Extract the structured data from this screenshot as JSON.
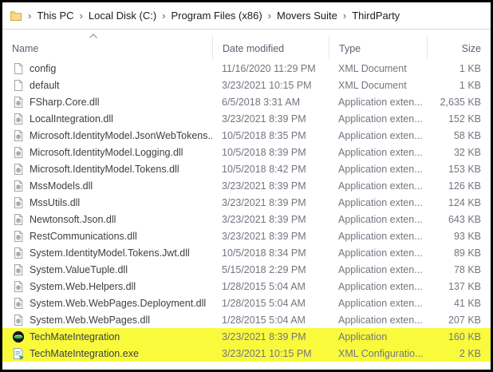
{
  "breadcrumb": {
    "icon": "folder-icon",
    "separator": "›",
    "items": [
      "This PC",
      "Local Disk (C:)",
      "Program Files (x86)",
      "Movers Suite",
      "ThirdParty"
    ]
  },
  "file_list": {
    "columns": [
      {
        "key": "name",
        "label": "Name",
        "sorted": "ascending"
      },
      {
        "key": "date",
        "label": "Date modified"
      },
      {
        "key": "type",
        "label": "Type"
      },
      {
        "key": "size",
        "label": "Size"
      }
    ],
    "rows": [
      {
        "icon": "xml-doc-icon",
        "name": "config",
        "date": "11/16/2020 11:29 PM",
        "type": "XML Document",
        "size": "1 KB",
        "highlighted": false
      },
      {
        "icon": "xml-doc-icon",
        "name": "default",
        "date": "3/23/2021 10:15 PM",
        "type": "XML Document",
        "size": "1 KB",
        "highlighted": false
      },
      {
        "icon": "dll-icon",
        "name": "FSharp.Core.dll",
        "date": "6/5/2018 3:31 AM",
        "type": "Application exten...",
        "size": "2,635 KB",
        "highlighted": false
      },
      {
        "icon": "dll-icon",
        "name": "LocalIntegration.dll",
        "date": "3/23/2021 8:39 PM",
        "type": "Application exten...",
        "size": "152 KB",
        "highlighted": false
      },
      {
        "icon": "dll-icon",
        "name": "Microsoft.IdentityModel.JsonWebTokens....",
        "date": "10/5/2018 8:35 PM",
        "type": "Application exten...",
        "size": "58 KB",
        "highlighted": false
      },
      {
        "icon": "dll-icon",
        "name": "Microsoft.IdentityModel.Logging.dll",
        "date": "10/5/2018 8:39 PM",
        "type": "Application exten...",
        "size": "32 KB",
        "highlighted": false
      },
      {
        "icon": "dll-icon",
        "name": "Microsoft.IdentityModel.Tokens.dll",
        "date": "10/5/2018 8:42 PM",
        "type": "Application exten...",
        "size": "153 KB",
        "highlighted": false
      },
      {
        "icon": "dll-icon",
        "name": "MssModels.dll",
        "date": "3/23/2021 8:39 PM",
        "type": "Application exten...",
        "size": "126 KB",
        "highlighted": false
      },
      {
        "icon": "dll-icon",
        "name": "MssUtils.dll",
        "date": "3/23/2021 8:39 PM",
        "type": "Application exten...",
        "size": "124 KB",
        "highlighted": false
      },
      {
        "icon": "dll-icon",
        "name": "Newtonsoft.Json.dll",
        "date": "3/23/2021 8:39 PM",
        "type": "Application exten...",
        "size": "643 KB",
        "highlighted": false
      },
      {
        "icon": "dll-icon",
        "name": "RestCommunications.dll",
        "date": "3/23/2021 8:39 PM",
        "type": "Application exten...",
        "size": "93 KB",
        "highlighted": false
      },
      {
        "icon": "dll-icon",
        "name": "System.IdentityModel.Tokens.Jwt.dll",
        "date": "10/5/2018 8:34 PM",
        "type": "Application exten...",
        "size": "89 KB",
        "highlighted": false
      },
      {
        "icon": "dll-icon",
        "name": "System.ValueTuple.dll",
        "date": "5/15/2018 2:29 PM",
        "type": "Application exten...",
        "size": "78 KB",
        "highlighted": false
      },
      {
        "icon": "dll-icon",
        "name": "System.Web.Helpers.dll",
        "date": "1/28/2015 5:04 AM",
        "type": "Application exten...",
        "size": "137 KB",
        "highlighted": false
      },
      {
        "icon": "dll-icon",
        "name": "System.Web.WebPages.Deployment.dll",
        "date": "1/28/2015 5:04 AM",
        "type": "Application exten...",
        "size": "41 KB",
        "highlighted": false
      },
      {
        "icon": "dll-icon",
        "name": "System.Web.WebPages.dll",
        "date": "1/28/2015 5:04 AM",
        "type": "Application exten...",
        "size": "207 KB",
        "highlighted": false
      },
      {
        "icon": "app-icon",
        "name": "TechMateIntegration",
        "date": "3/23/2021 8:39 PM",
        "type": "Application",
        "size": "160 KB",
        "highlighted": true
      },
      {
        "icon": "xml-config-icon",
        "name": "TechMateIntegration.exe",
        "date": "3/23/2021 10:15 PM",
        "type": "XML Configuratio...",
        "size": "2 KB",
        "highlighted": true
      }
    ]
  },
  "colors": {
    "highlight": "#fafa3d",
    "header_text": "#5a6372",
    "name_text": "#3c4043",
    "meta_text": "#717680",
    "folder_yellow": "#f7dc84"
  }
}
